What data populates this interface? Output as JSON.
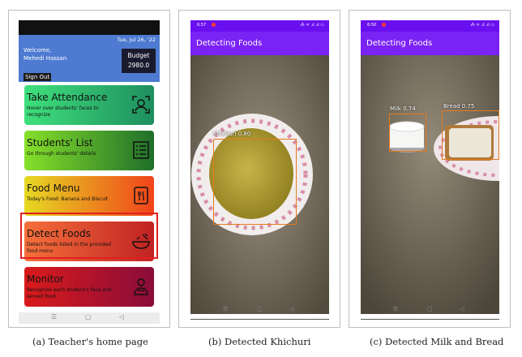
{
  "panel_a": {
    "date": "Tue, Jul 26, '22",
    "welcome": "Welcome,",
    "user_name": "Mehedi Hassan",
    "budget_label": "Budget",
    "budget_value": "2980.0",
    "sign_out": "Sign Out",
    "cards": [
      {
        "title": "Take Attendance",
        "desc": "Hover over students' faces to recognize",
        "icon": "face-scan-icon",
        "color_from": "#3fe07c",
        "color_to": "#1e8e5e"
      },
      {
        "title": "Students' List",
        "desc": "Go through students' details",
        "icon": "list-icon",
        "color_from": "#86e02a",
        "color_to": "#1f6f2a"
      },
      {
        "title": "Food Menu",
        "desc": "Today's Food: Banana and Biscuit",
        "icon": "menu-card-icon",
        "color_from": "#e6d923",
        "color_to": "#f0431a"
      },
      {
        "title": "Detect Foods",
        "desc": "Detect foods listed in the provided food menu",
        "icon": "food-bowl-icon",
        "color_from": "#f5703b",
        "color_to": "#c02222",
        "highlighted": true
      },
      {
        "title": "Monitor",
        "desc": "Recognize each student's face and served food",
        "icon": "person-food-icon",
        "color_from": "#d91b1b",
        "color_to": "#8a0c3a"
      }
    ],
    "highlight_color": "#e02020",
    "nav": [
      "☰",
      "▢",
      "◁"
    ],
    "caption": "(a) Teacher's home page"
  },
  "panel_b": {
    "time": "6:57",
    "status_icons": "⁂ ᯤ .ıl .ıl ▭",
    "title": "Detecting Foods",
    "detections": [
      {
        "label": "Khichuri 0.80"
      }
    ],
    "nav": [
      "☰",
      "▢",
      "◁"
    ],
    "caption": "(b) Detected Khichuri"
  },
  "panel_c": {
    "time": "6:50",
    "status_icons": "⁂ ᯤ .ıl .ıl ▭",
    "title": "Detecting Foods",
    "detections": [
      {
        "label": "Milk 0.74"
      },
      {
        "label": "Bread 0.75"
      }
    ],
    "nav": [
      "☰",
      "▢",
      "◁"
    ],
    "caption": "(c) Detected Milk and Bread"
  },
  "colors": {
    "appbar": "#7b22f5",
    "statusbar": "#6a0ff0",
    "box": "#e47a1f",
    "header": "#4e7bd1"
  }
}
